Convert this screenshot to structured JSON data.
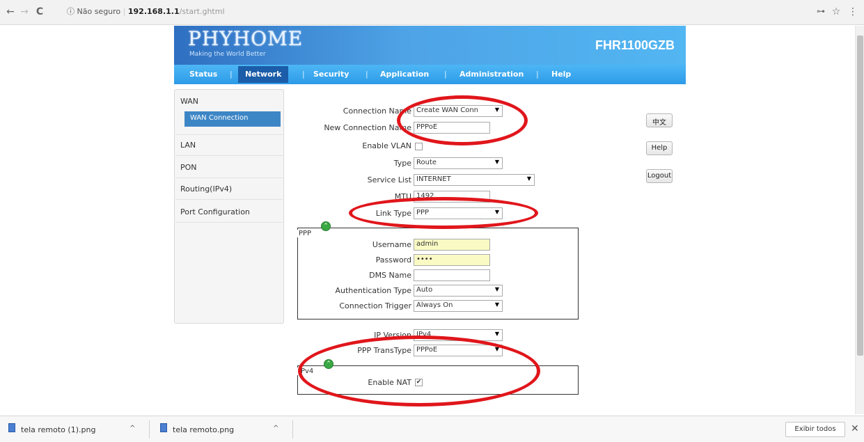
{
  "browser": {
    "back_icon": "←",
    "forward_icon": "→",
    "reload_icon": "C",
    "security_text": "ⓘ Não seguro",
    "url_host": "192.168.1.1",
    "url_path": "/start.ghtml",
    "key_icon": "⊶",
    "star_icon": "☆",
    "menu_icon": "⋮"
  },
  "header": {
    "logo": "PHYHOME",
    "slogan": "Making the World Better",
    "model": "FHR1100GZB"
  },
  "menu": {
    "items": [
      "Status",
      "Network",
      "Security",
      "Application",
      "Administration",
      "Help"
    ],
    "separator": "|"
  },
  "sidebar": {
    "section": "WAN",
    "active_sub": "WAN Connection",
    "items": [
      "LAN",
      "PON",
      "Routing(IPv4)",
      "Port Configuration"
    ]
  },
  "form": {
    "connection_name_label": "Connection Name",
    "connection_name_value": "Create WAN Conn",
    "new_connection_name_label": "New Connection Name",
    "new_connection_name_value": "PPPoE",
    "enable_vlan_label": "Enable VLAN",
    "type_label": "Type",
    "type_value": "Route",
    "service_list_label": "Service List",
    "service_list_value": "INTERNET",
    "mtu_label": "MTU",
    "mtu_value": "1492",
    "link_type_label": "Link Type",
    "link_type_value": "PPP",
    "ppp_legend": "PPP",
    "username_label": "Username",
    "username_value": "admin",
    "password_label": "Password",
    "password_value": "••••",
    "dns_name_label": "DMS Name",
    "dns_name_value": "",
    "auth_type_label": "Authentication Type",
    "auth_type_value": "Auto",
    "conn_trigger_label": "Connection Trigger",
    "conn_trigger_value": "Always On",
    "ip_version_label": "IP Version",
    "ip_version_value": "IPv4",
    "ppp_transtype_label": "PPP TransType",
    "ppp_transtype_value": "PPPoE",
    "ipv4_legend": "IPv4",
    "enable_nat_label": "Enable NAT",
    "checkmark": "✔",
    "dropdown_arrow": "▼",
    "collapse_icon": "⌃"
  },
  "right_buttons": {
    "lang": "中文",
    "help": "Help",
    "logout": "Logout"
  },
  "downloads": {
    "files": [
      "tela remoto (1).png",
      "tela remoto.png"
    ],
    "caret": "^",
    "show_all": "Exibir todos",
    "close": "✕"
  }
}
